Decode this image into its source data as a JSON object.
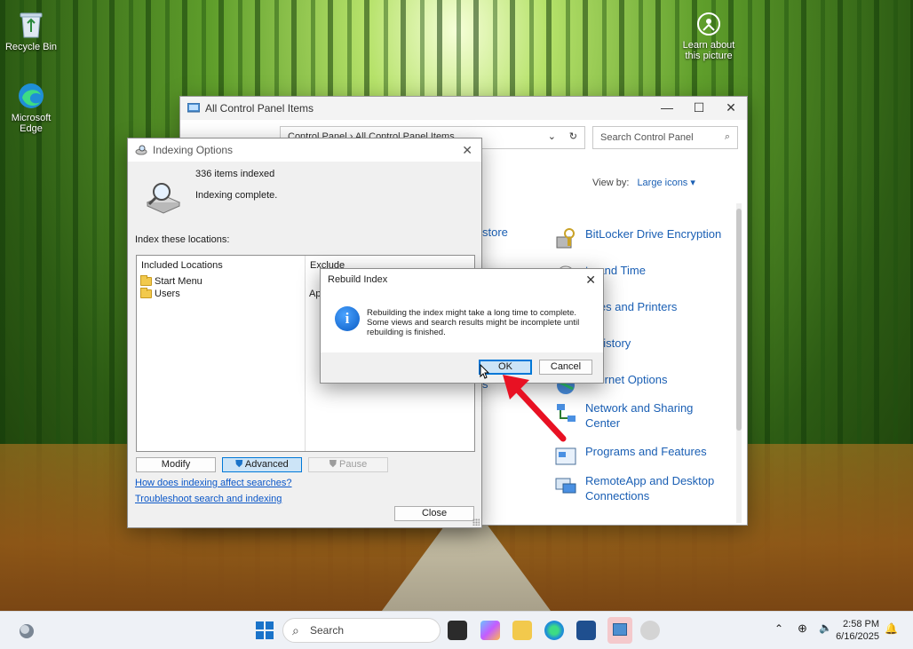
{
  "desktop": {
    "icons": [
      {
        "label": "Recycle Bin"
      },
      {
        "label": "Microsoft Edge"
      },
      {
        "label": "Learn about this picture"
      }
    ]
  },
  "control_panel": {
    "title": "All Control Panel Items",
    "breadcrumb": [
      "Control Panel",
      "All Control Panel Items"
    ],
    "search_placeholder": "Search Control Panel",
    "view_by_label": "View by:",
    "view_by_value": "Large icons",
    "partial_left_item": "store",
    "partial_left_item2": "s",
    "items": [
      {
        "label": "BitLocker Drive Encryption"
      },
      {
        "label": "te and Time"
      },
      {
        "label": "vices and Printers"
      },
      {
        "label": "e History"
      },
      {
        "label": "Internet Options"
      },
      {
        "label": "Network and Sharing Center"
      },
      {
        "label": "Programs and Features"
      },
      {
        "label": "RemoteApp and Desktop Connections"
      }
    ]
  },
  "indexing_options": {
    "title": "Indexing Options",
    "items_indexed": "336 items indexed",
    "status": "Indexing complete.",
    "locations_label": "Index these locations:",
    "columns": {
      "included": "Included Locations",
      "exclude": "Exclude"
    },
    "locations": [
      "Start Menu",
      "Users"
    ],
    "exclude_partial": "App",
    "buttons": {
      "modify": "Modify",
      "advanced": "Advanced",
      "pause": "Pause",
      "close": "Close"
    },
    "links": {
      "affect": "How does indexing affect searches?",
      "troubleshoot": "Troubleshoot search and indexing"
    }
  },
  "rebuild_dialog": {
    "title": "Rebuild Index",
    "message": "Rebuilding the index might take a long time to complete. Some views and search results might be incomplete until rebuilding is finished.",
    "ok": "OK",
    "cancel": "Cancel"
  },
  "taskbar": {
    "search_placeholder": "Search",
    "time": "2:58 PM",
    "date": "6/16/2025"
  },
  "colors": {
    "accent": "#0078d7",
    "arrow": "#e81123",
    "link": "#1a5fb4"
  }
}
